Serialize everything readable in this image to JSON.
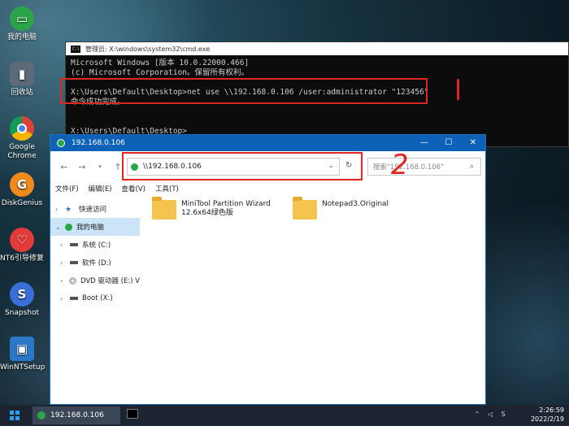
{
  "desktop": {
    "icons": [
      {
        "label": "我的电脑",
        "glyph": "▭",
        "color": "#2aa54a"
      },
      {
        "label": "回收站",
        "glyph": "🗑",
        "color": "#5a6a78"
      },
      {
        "label": "Google Chrome",
        "glyph": "◉",
        "color": "#d94436"
      },
      {
        "label": "DiskGenius",
        "glyph": "G",
        "color": "#f08a1c"
      },
      {
        "label": "NT6引导修复",
        "glyph": "♡",
        "color": "#e43a3a"
      },
      {
        "label": "Snapshot",
        "glyph": "S",
        "color": "#3a6fd8"
      },
      {
        "label": "WinNTSetup",
        "glyph": "▣",
        "color": "#2b78c8"
      }
    ]
  },
  "cmd": {
    "title": "管理员: X:\\windows\\system32\\cmd.exe",
    "lines": [
      "Microsoft Windows [版本 10.0.22000.466]",
      "(c) Microsoft Corporation。保留所有权利。",
      "",
      "X:\\Users\\Default\\Desktop>net use \\\\192.168.0.106 /user:administrator \"123456\"",
      "命令成功完成。",
      "",
      "",
      "X:\\Users\\Default\\Desktop>"
    ]
  },
  "annotations": {
    "mark1": "|",
    "mark2": "2",
    "color": "#e0261f"
  },
  "explorer": {
    "title": "192.168.0.106",
    "address": "\\\\192.168.0.106",
    "search_placeholder": "搜索\"192.168.0.106\"",
    "menu": [
      "文件(F)",
      "编辑(E)",
      "查看(V)",
      "工具(T)"
    ],
    "sidebar": [
      {
        "label": "快速访问",
        "icon": "star-icon"
      },
      {
        "label": "我的电脑",
        "icon": "computer-icon"
      },
      {
        "label": "系统 (C:)",
        "icon": "drive-icon"
      },
      {
        "label": "软件 (D:)",
        "icon": "drive-icon"
      },
      {
        "label": "DVD 驱动器 (E:) V",
        "icon": "dvd-icon"
      },
      {
        "label": "Boot (X:)",
        "icon": "drive-icon"
      }
    ],
    "files": [
      {
        "name": "MiniTool Partition Wizard",
        "sub": "12.6x64绿色版"
      },
      {
        "name": "Notepad3.Original",
        "sub": ""
      }
    ]
  },
  "taskbar": {
    "active_item": "192.168.0.106",
    "time": "2:26:59",
    "date": "2022/2/19"
  }
}
